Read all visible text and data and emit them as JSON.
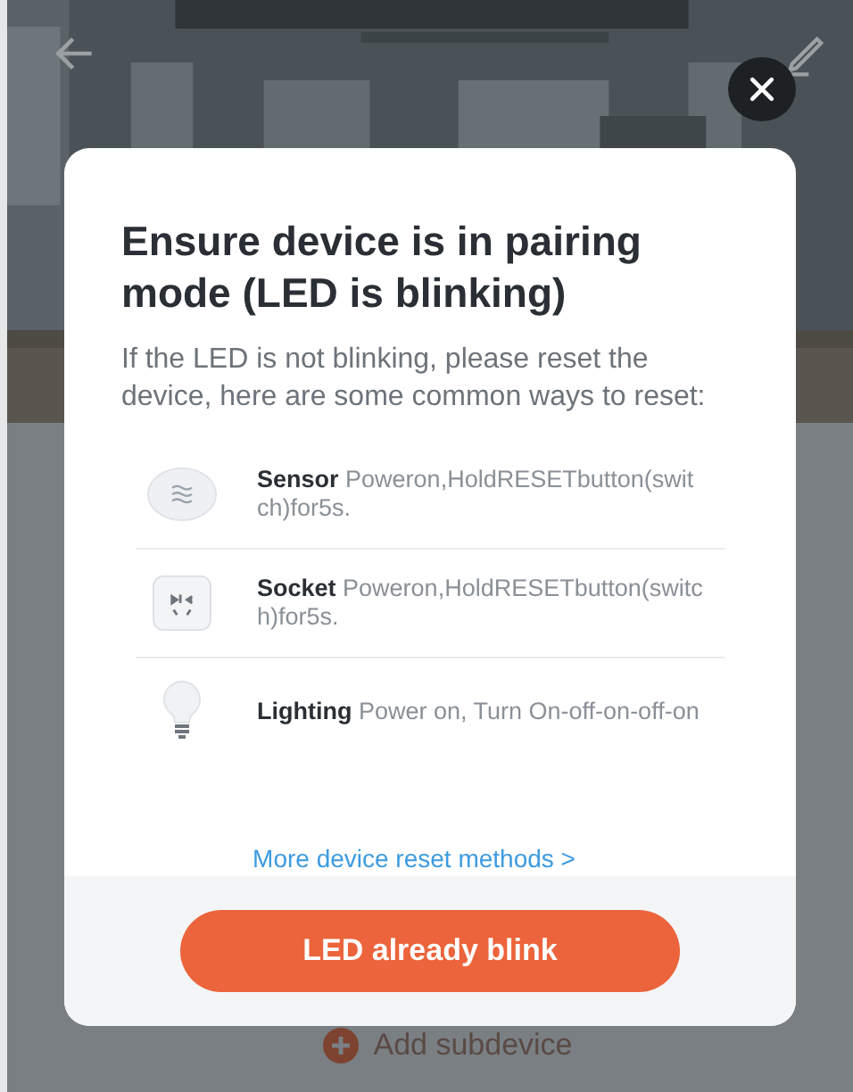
{
  "background": {
    "add_subdevice": "Add subdevice"
  },
  "modal": {
    "title": "Ensure device is in pairing mode (LED is blinking)",
    "description": "If the LED is not blinking, please reset the device, here are some common ways to reset:",
    "reset_methods": [
      {
        "kind": "sensor",
        "name": "Sensor",
        "instructions": "Poweron,HoldRESETbutton(switch)for5s."
      },
      {
        "kind": "socket",
        "name": "Socket",
        "instructions": "Poweron,HoldRESETbutton(switch)for5s."
      },
      {
        "kind": "lighting",
        "name": "Lighting",
        "instructions": "Power on, Turn On-off-on-off-on"
      }
    ],
    "more_link": "More device reset methods >",
    "confirm_button": "LED already blink"
  }
}
